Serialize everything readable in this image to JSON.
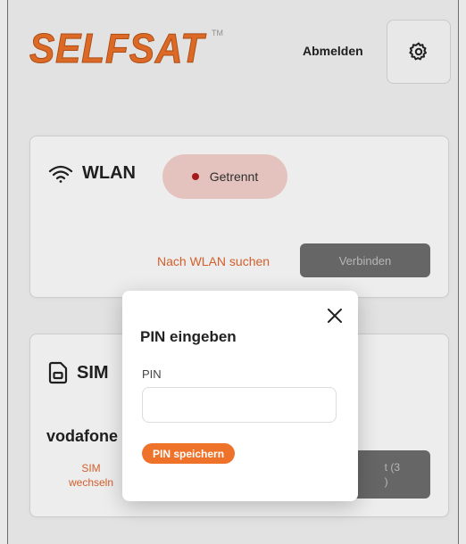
{
  "header": {
    "logo_text": "SELFSAT",
    "logo_mark": "TM",
    "logout_label": "Abmelden",
    "settings_icon": "gear-icon"
  },
  "wlan": {
    "title": "WLAN",
    "icon": "wifi-icon",
    "status": "Getrennt",
    "status_color": "#b21e1e",
    "search_link": "Nach WLAN suchen",
    "connect_label": "Verbinden"
  },
  "sim": {
    "title": "SIM",
    "icon": "sim-card-icon",
    "provider": "vodafone",
    "switch_label_1": "SIM",
    "switch_label_2": "wechseln",
    "button_line_1": "t (3",
    "button_line_2": ")"
  },
  "modal": {
    "title": "PIN eingeben",
    "pin_label": "PIN",
    "pin_value": "",
    "pin_placeholder": "",
    "save_label": "PIN speichern",
    "close_icon": "close-icon"
  },
  "colors": {
    "accent": "#ee7229",
    "link": "#e4672f",
    "disabled_button": "#6e6e6e",
    "status_pill": "#f6d2cd"
  }
}
